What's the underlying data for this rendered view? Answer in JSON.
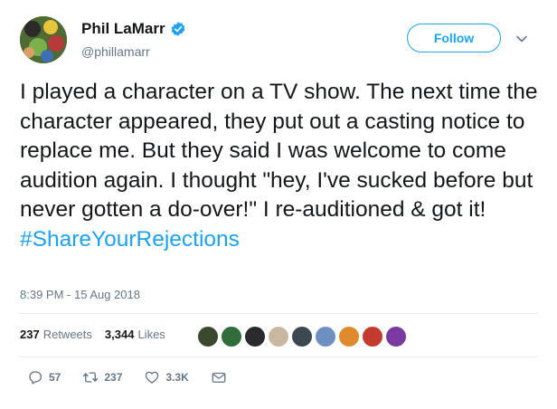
{
  "author": {
    "display_name": "Phil LaMarr",
    "handle": "@phillamarr"
  },
  "follow_label": "Follow",
  "tweet": {
    "text": "I played a character on a TV show. The next time the character appeared, they put out a casting notice to replace me. But they said I was welcome to come audition again. I thought \"hey, I've sucked before but never gotten a do-over!\" I re-auditioned & got it!",
    "hashtag": "#ShareYourRejections",
    "timestamp": "8:39 PM - 15 Aug 2018"
  },
  "stats": {
    "retweets_count": "237",
    "retweets_label": "Retweets",
    "likes_count": "3,344",
    "likes_label": "Likes"
  },
  "liker_avatars": [
    "#3b4a2e",
    "#2f6e3a",
    "#2a2a2a",
    "#c9b8a0",
    "#3c4750",
    "#6d8fc1",
    "#e08a2e",
    "#c23b2e",
    "#7b3aa0"
  ],
  "actions": {
    "reply_count": "57",
    "retweet_count": "237",
    "like_count": "3.3K"
  },
  "colors": {
    "accent": "#1da1f2",
    "muted": "#657786",
    "text": "#14171a"
  }
}
